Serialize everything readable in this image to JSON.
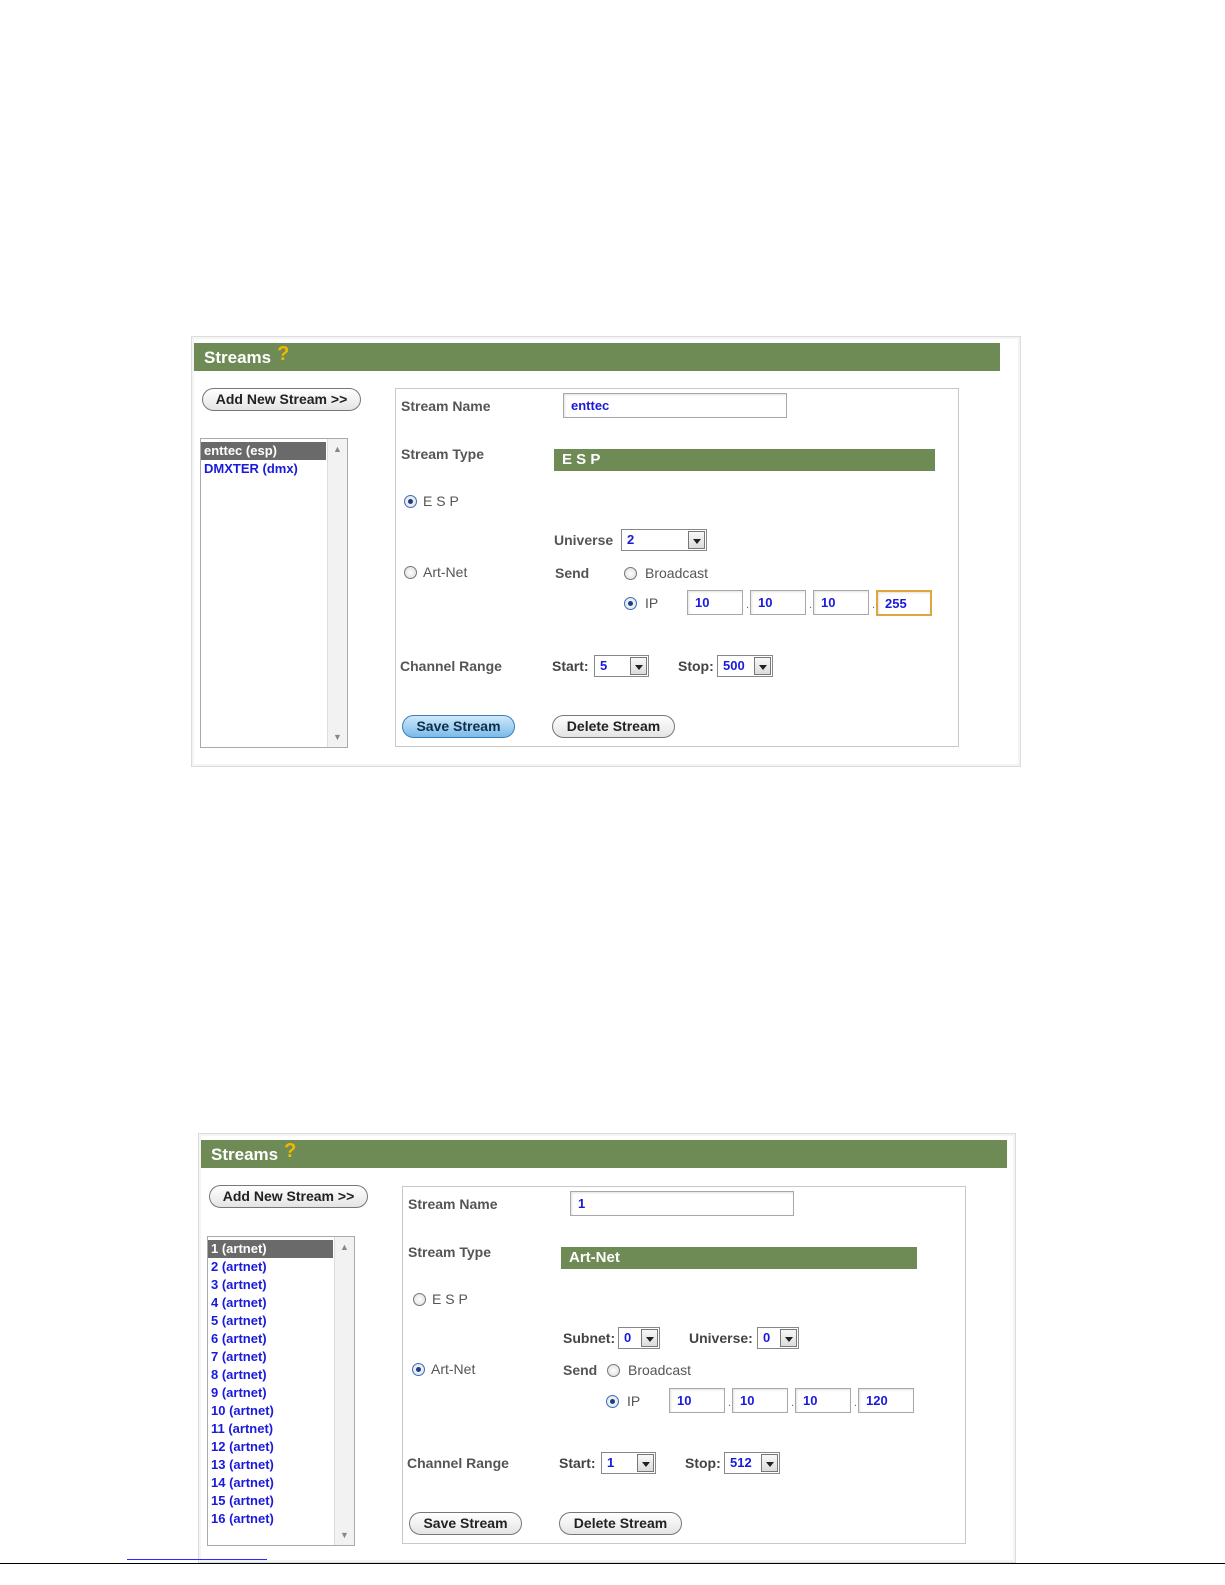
{
  "screens": [
    {
      "title": "Streams",
      "add_button": "Add New Stream >>",
      "streams": [
        {
          "label": "enttec (esp)",
          "selected": true
        },
        {
          "label": "DMXTER (dmx)",
          "selected": false
        }
      ],
      "stream_name_label": "Stream Name",
      "stream_name_value": "enttec",
      "stream_type_label": "Stream Type",
      "stream_type_value": "E S P",
      "esp_label": "E S P",
      "artnet_label": "Art-Net",
      "universe_label": "Universe",
      "universe_value": "2",
      "send_label": "Send",
      "broadcast_label": "Broadcast",
      "ip_label": "IP",
      "ip": [
        "10",
        "10",
        "10",
        "255"
      ],
      "channel_range_label": "Channel Range",
      "start_label": "Start:",
      "start_value": "5",
      "stop_label": "Stop:",
      "stop_value": "500",
      "save_button": "Save Stream",
      "delete_button": "Delete Stream"
    },
    {
      "title": "Streams",
      "add_button": "Add New Stream >>",
      "streams": [
        {
          "label": "1 (artnet)",
          "selected": true
        },
        {
          "label": "2 (artnet)",
          "selected": false
        },
        {
          "label": "3 (artnet)",
          "selected": false
        },
        {
          "label": "4 (artnet)",
          "selected": false
        },
        {
          "label": "5 (artnet)",
          "selected": false
        },
        {
          "label": "6 (artnet)",
          "selected": false
        },
        {
          "label": "7 (artnet)",
          "selected": false
        },
        {
          "label": "8 (artnet)",
          "selected": false
        },
        {
          "label": "9 (artnet)",
          "selected": false
        },
        {
          "label": "10 (artnet)",
          "selected": false
        },
        {
          "label": "11 (artnet)",
          "selected": false
        },
        {
          "label": "12 (artnet)",
          "selected": false
        },
        {
          "label": "13 (artnet)",
          "selected": false
        },
        {
          "label": "14 (artnet)",
          "selected": false
        },
        {
          "label": "15 (artnet)",
          "selected": false
        },
        {
          "label": "16 (artnet)",
          "selected": false
        }
      ],
      "stream_name_label": "Stream Name",
      "stream_name_value": "1",
      "stream_type_label": "Stream Type",
      "stream_type_value": "Art-Net",
      "esp_label": "E S P",
      "artnet_label": "Art-Net",
      "subnet_label": "Subnet:",
      "subnet_value": "0",
      "universe_label": "Universe:",
      "universe_value": "0",
      "send_label": "Send",
      "broadcast_label": "Broadcast",
      "ip_label": "IP",
      "ip": [
        "10",
        "10",
        "10",
        "120"
      ],
      "channel_range_label": "Channel Range",
      "start_label": "Start:",
      "start_value": "1",
      "stop_label": "Stop:",
      "stop_value": "512",
      "save_button": "Save Stream",
      "delete_button": "Delete Stream"
    }
  ]
}
